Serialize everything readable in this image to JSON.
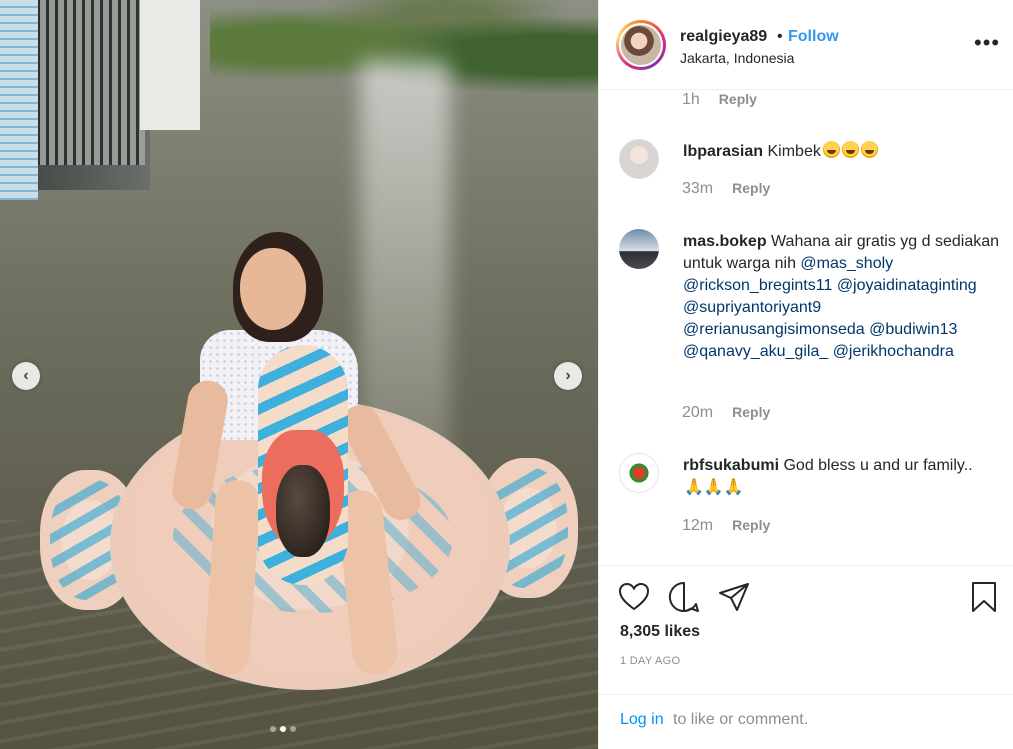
{
  "post": {
    "username": "realgieya89",
    "separator": "•",
    "follow_label": "Follow",
    "location": "Jakarta, Indonesia",
    "more_icon": "more-options-icon"
  },
  "carousel": {
    "prev_icon": "chevron-left-icon",
    "next_icon": "chevron-right-icon",
    "dot_count": 3,
    "active_dot": 2
  },
  "top_meta": {
    "time": "1h",
    "reply": "Reply"
  },
  "comments": [
    {
      "user": "lbparasian",
      "text": "Kimbek",
      "emoji": [
        "rolling-laugh",
        "rolling-laugh",
        "rolling-laugh"
      ],
      "time": "33m",
      "reply": "Reply"
    },
    {
      "user": "mas.bokep",
      "text": "Wahana air gratis yg d sediakan untuk warga nih",
      "mentions": [
        "@mas_sholy",
        "@rickson_bregints11",
        "@joyaidinataginting",
        "@supriyantoriyant9",
        "@rerianusangisimonseda",
        "@budiwin13",
        "@qanavy_aku_gila_",
        "@jerikhochandra"
      ],
      "time": "20m",
      "reply": "Reply"
    },
    {
      "user": "rbfsukabumi",
      "text": "God bless u and ur family..",
      "pray": "🙏🙏🙏",
      "time": "12m",
      "reply": "Reply"
    }
  ],
  "actions": {
    "like_icon": "heart-icon",
    "comment_icon": "comment-icon",
    "share_icon": "share-icon",
    "save_icon": "bookmark-icon",
    "likes": "8,305 likes",
    "date": "1 DAY AGO"
  },
  "login": {
    "link": "Log in",
    "rest": "to like or comment."
  },
  "colors": {
    "link_blue": "#3897f0",
    "login_blue": "#0095f6",
    "muted": "#8e8e8e",
    "text": "#262626"
  }
}
